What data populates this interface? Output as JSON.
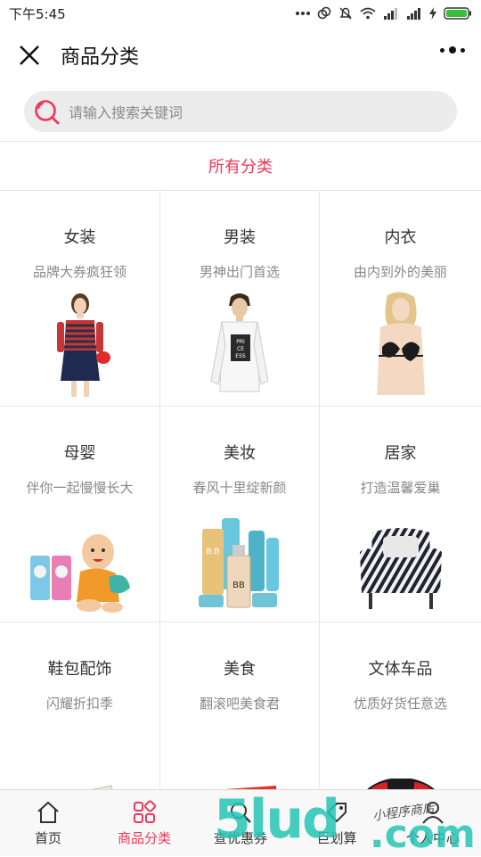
{
  "status": {
    "time": "下午5:45"
  },
  "nav": {
    "title": "商品分类"
  },
  "search": {
    "placeholder": "请输入搜索关键词"
  },
  "section": {
    "title": "所有分类"
  },
  "categories": [
    {
      "name": "女装",
      "desc": "品牌大券疯狂领",
      "icon": "woman-fashion"
    },
    {
      "name": "男装",
      "desc": "男神出门首选",
      "icon": "man-fashion"
    },
    {
      "name": "内衣",
      "desc": "由内到外的美丽",
      "icon": "lingerie"
    },
    {
      "name": "母婴",
      "desc": "伴你一起慢慢长大",
      "icon": "baby"
    },
    {
      "name": "美妆",
      "desc": "春风十里绽新颜",
      "icon": "cosmetics"
    },
    {
      "name": "居家",
      "desc": "打造温馨爱巢",
      "icon": "armchair"
    },
    {
      "name": "鞋包配饰",
      "desc": "闪耀折扣季",
      "icon": "shoe"
    },
    {
      "name": "美食",
      "desc": "翻滚吧美食君",
      "icon": "snack-box"
    },
    {
      "name": "文体车品",
      "desc": "优质好货任意选",
      "icon": "steering-wheel"
    }
  ],
  "tabs": [
    {
      "label": "首页",
      "icon": "home-icon"
    },
    {
      "label": "商品分类",
      "icon": "category-icon"
    },
    {
      "label": "查优惠券",
      "icon": "search-icon"
    },
    {
      "label": "巨划算",
      "icon": "tag-icon"
    },
    {
      "label": "个人中心",
      "icon": "user-icon"
    }
  ],
  "watermark": {
    "main": "5lud",
    "suffix": ".com",
    "script": "小程序商店"
  },
  "colors": {
    "accent": "#f0365a",
    "watermark": "#24c4b4"
  }
}
